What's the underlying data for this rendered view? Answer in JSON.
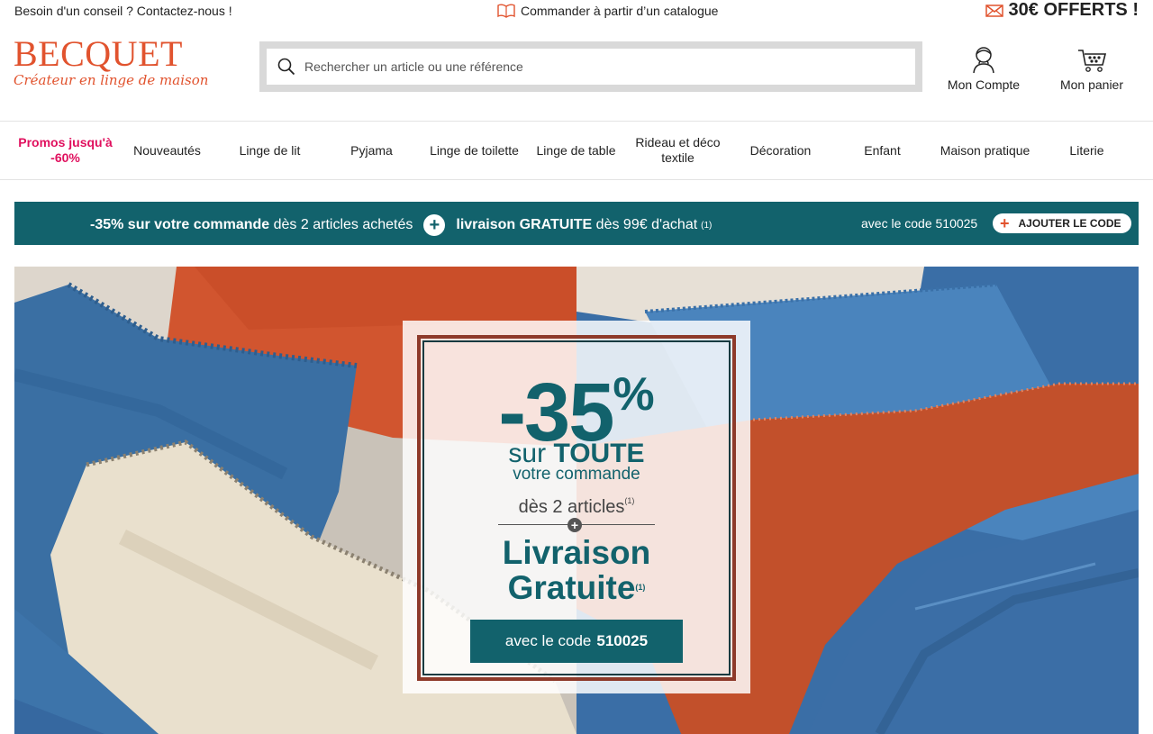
{
  "topbar": {
    "help_text": "Besoin d'un conseil ? Contactez-nous !",
    "catalog_text": "Commander à partir d’un catalogue",
    "offer_text": "30€ OFFERTS !"
  },
  "header": {
    "logo_word": "BECQUET",
    "logo_tagline": "Créateur en linge de maison",
    "search_placeholder": "Rechercher un article ou une référence",
    "account_label": "Mon Compte",
    "cart_label": "Mon panier"
  },
  "nav": {
    "items": [
      "Promos jusqu'à -60%",
      "Nouveautés",
      "Linge de lit",
      "Pyjama",
      "Linge de toilette",
      "Linge de table",
      "Rideau et déco textile",
      "Décoration",
      "Enfant",
      "Maison pratique",
      "Literie"
    ]
  },
  "promo_bar": {
    "offer1_bold": "-35% sur votre commande",
    "offer1_rest": " dès 2 articles achetés",
    "offer2_bold": "livraison GRATUITE",
    "offer2_rest": " dès 99€ d'achat",
    "footnote": "(1)",
    "code_text": "avec le code 510025",
    "button_label": "AJOUTER LE CODE"
  },
  "hero": {
    "percent": "-35",
    "percent_symbol": "%",
    "line1_a": "sur ",
    "line1_b": "TOUTE",
    "line2": "votre commande",
    "line3": "dès 2 articles",
    "footnote": "(1)",
    "line4": "Livraison",
    "line5": "Gratuite",
    "cta_text": "avec le code",
    "cta_code": "510025"
  },
  "colors": {
    "brand_orange": "#e1532e",
    "teal": "#12626c",
    "promo_pink": "#e0105e"
  }
}
